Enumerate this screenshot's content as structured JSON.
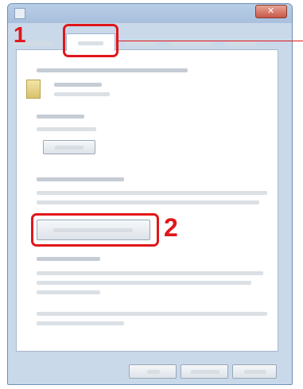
{
  "dialog": {
    "callouts": [
      "1",
      "2"
    ],
    "colors": {
      "highlight": "#e0161a",
      "window_frame": "#c9d9ea",
      "titlebar": "#a8c0dd"
    }
  }
}
